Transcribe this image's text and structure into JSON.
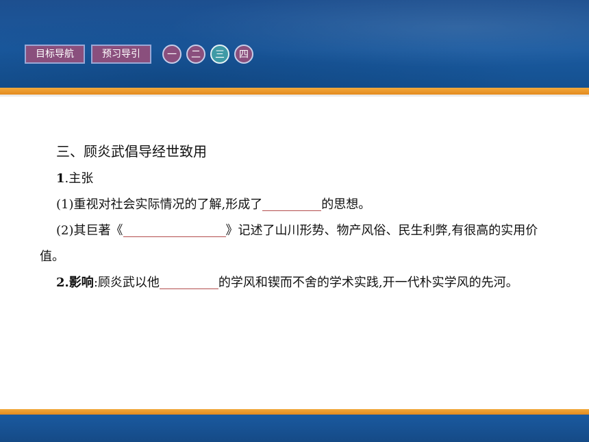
{
  "nav": {
    "tabs": [
      "目标导航",
      "预习导引"
    ],
    "sections": [
      "一",
      "二",
      "三",
      "四"
    ],
    "active_section": "三"
  },
  "content": {
    "section_title": "三、顾炎武倡导经世致用",
    "point1": {
      "number": "1",
      "heading": ".主张",
      "item1_before": "(1)重视对社会实际情况的了解,形成了",
      "item1_after": "的思想。",
      "item2_before": "(2)其巨著《",
      "item2_after": "》记述了山川形势、物产风俗、民生利弊,有很高的实用价值。"
    },
    "point2": {
      "number": "2",
      "heading": ".影响",
      "text_before": ":顾炎武以他",
      "text_after": "的学风和锲而不舍的学术实践,开一代朴实学风的先河。"
    }
  },
  "colors": {
    "header_blue": "#1a5aa0",
    "accent_orange": "#e38a1f",
    "tab_purple": "#8a4f7d",
    "active_teal": "#3f9aa6",
    "blank_line": "#b24c4c"
  }
}
